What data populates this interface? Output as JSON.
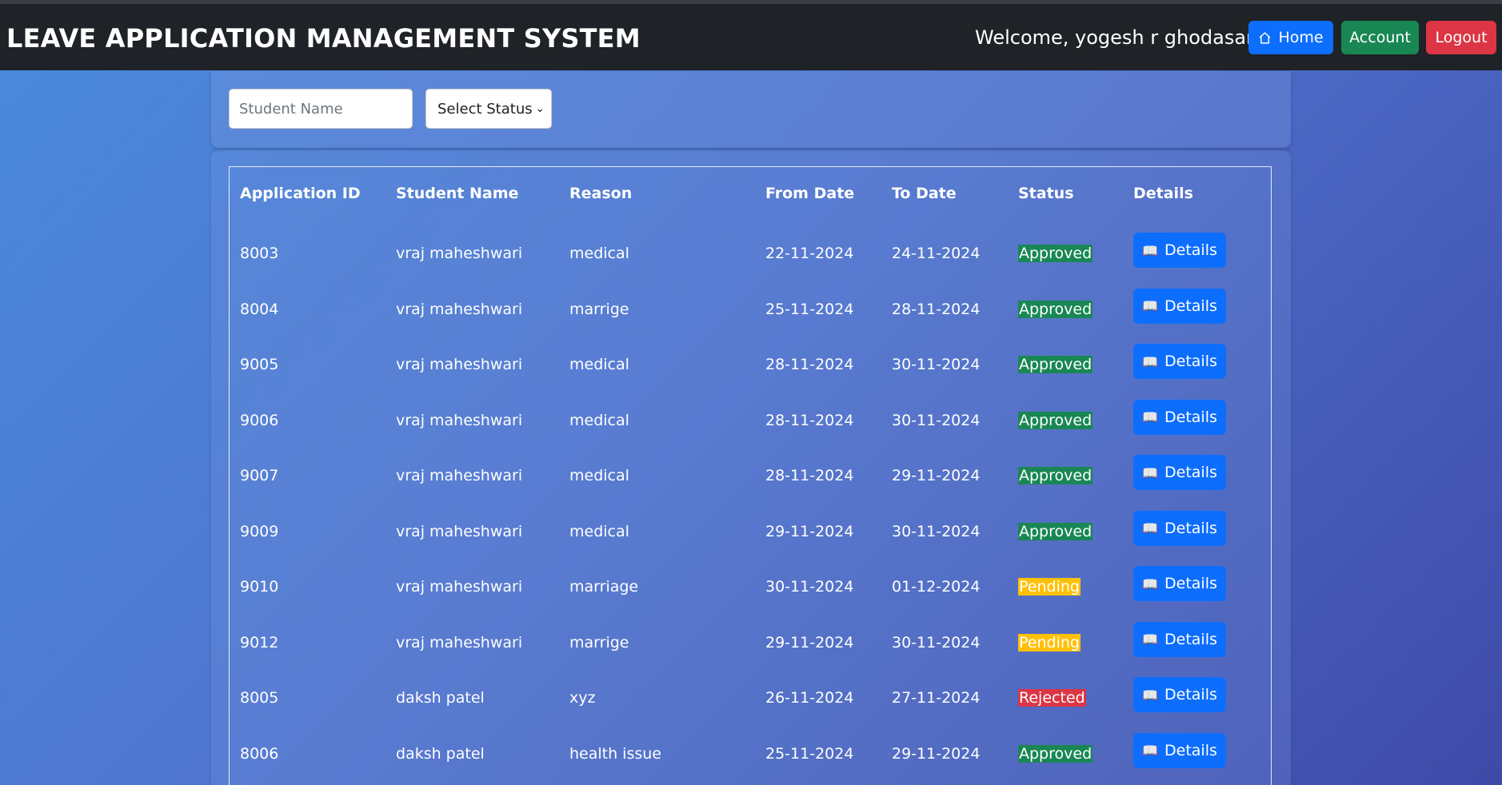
{
  "navbar": {
    "brand": "LEAVE APPLICATION MANAGEMENT SYSTEM",
    "welcome": "Welcome, yogesh r ghodasara",
    "home_label": "Home",
    "account_label": "Account",
    "logout_label": "Logout"
  },
  "filters": {
    "name_placeholder": "Student Name",
    "name_value": "",
    "status_selected": "Select Status"
  },
  "table": {
    "headers": [
      "Application ID",
      "Student Name",
      "Reason",
      "From Date",
      "To Date",
      "Status",
      "Details"
    ],
    "details_label": "Details",
    "rows": [
      {
        "id": "8003",
        "name": "vraj maheshwari",
        "reason": "medical",
        "from": "22-11-2024",
        "to": "24-11-2024",
        "status": "Approved"
      },
      {
        "id": "8004",
        "name": "vraj maheshwari",
        "reason": "marrige",
        "from": "25-11-2024",
        "to": "28-11-2024",
        "status": "Approved"
      },
      {
        "id": "9005",
        "name": "vraj maheshwari",
        "reason": "medical",
        "from": "28-11-2024",
        "to": "30-11-2024",
        "status": "Approved"
      },
      {
        "id": "9006",
        "name": "vraj maheshwari",
        "reason": "medical",
        "from": "28-11-2024",
        "to": "30-11-2024",
        "status": "Approved"
      },
      {
        "id": "9007",
        "name": "vraj maheshwari",
        "reason": "medical",
        "from": "28-11-2024",
        "to": "29-11-2024",
        "status": "Approved"
      },
      {
        "id": "9009",
        "name": "vraj maheshwari",
        "reason": "medical",
        "from": "29-11-2024",
        "to": "30-11-2024",
        "status": "Approved"
      },
      {
        "id": "9010",
        "name": "vraj maheshwari",
        "reason": "marriage",
        "from": "30-11-2024",
        "to": "01-12-2024",
        "status": "Pending"
      },
      {
        "id": "9012",
        "name": "vraj maheshwari",
        "reason": "marrige",
        "from": "29-11-2024",
        "to": "30-11-2024",
        "status": "Pending"
      },
      {
        "id": "8005",
        "name": "daksh patel",
        "reason": "xyz",
        "from": "26-11-2024",
        "to": "27-11-2024",
        "status": "Rejected"
      },
      {
        "id": "8006",
        "name": "daksh patel",
        "reason": "health issue",
        "from": "25-11-2024",
        "to": "29-11-2024",
        "status": "Approved"
      }
    ]
  },
  "colors": {
    "approved": "#198754",
    "pending": "#ffc107",
    "rejected": "#dc3545",
    "primary": "#0d6efd"
  },
  "icons": {
    "home": "home-icon",
    "details": "book-icon"
  }
}
